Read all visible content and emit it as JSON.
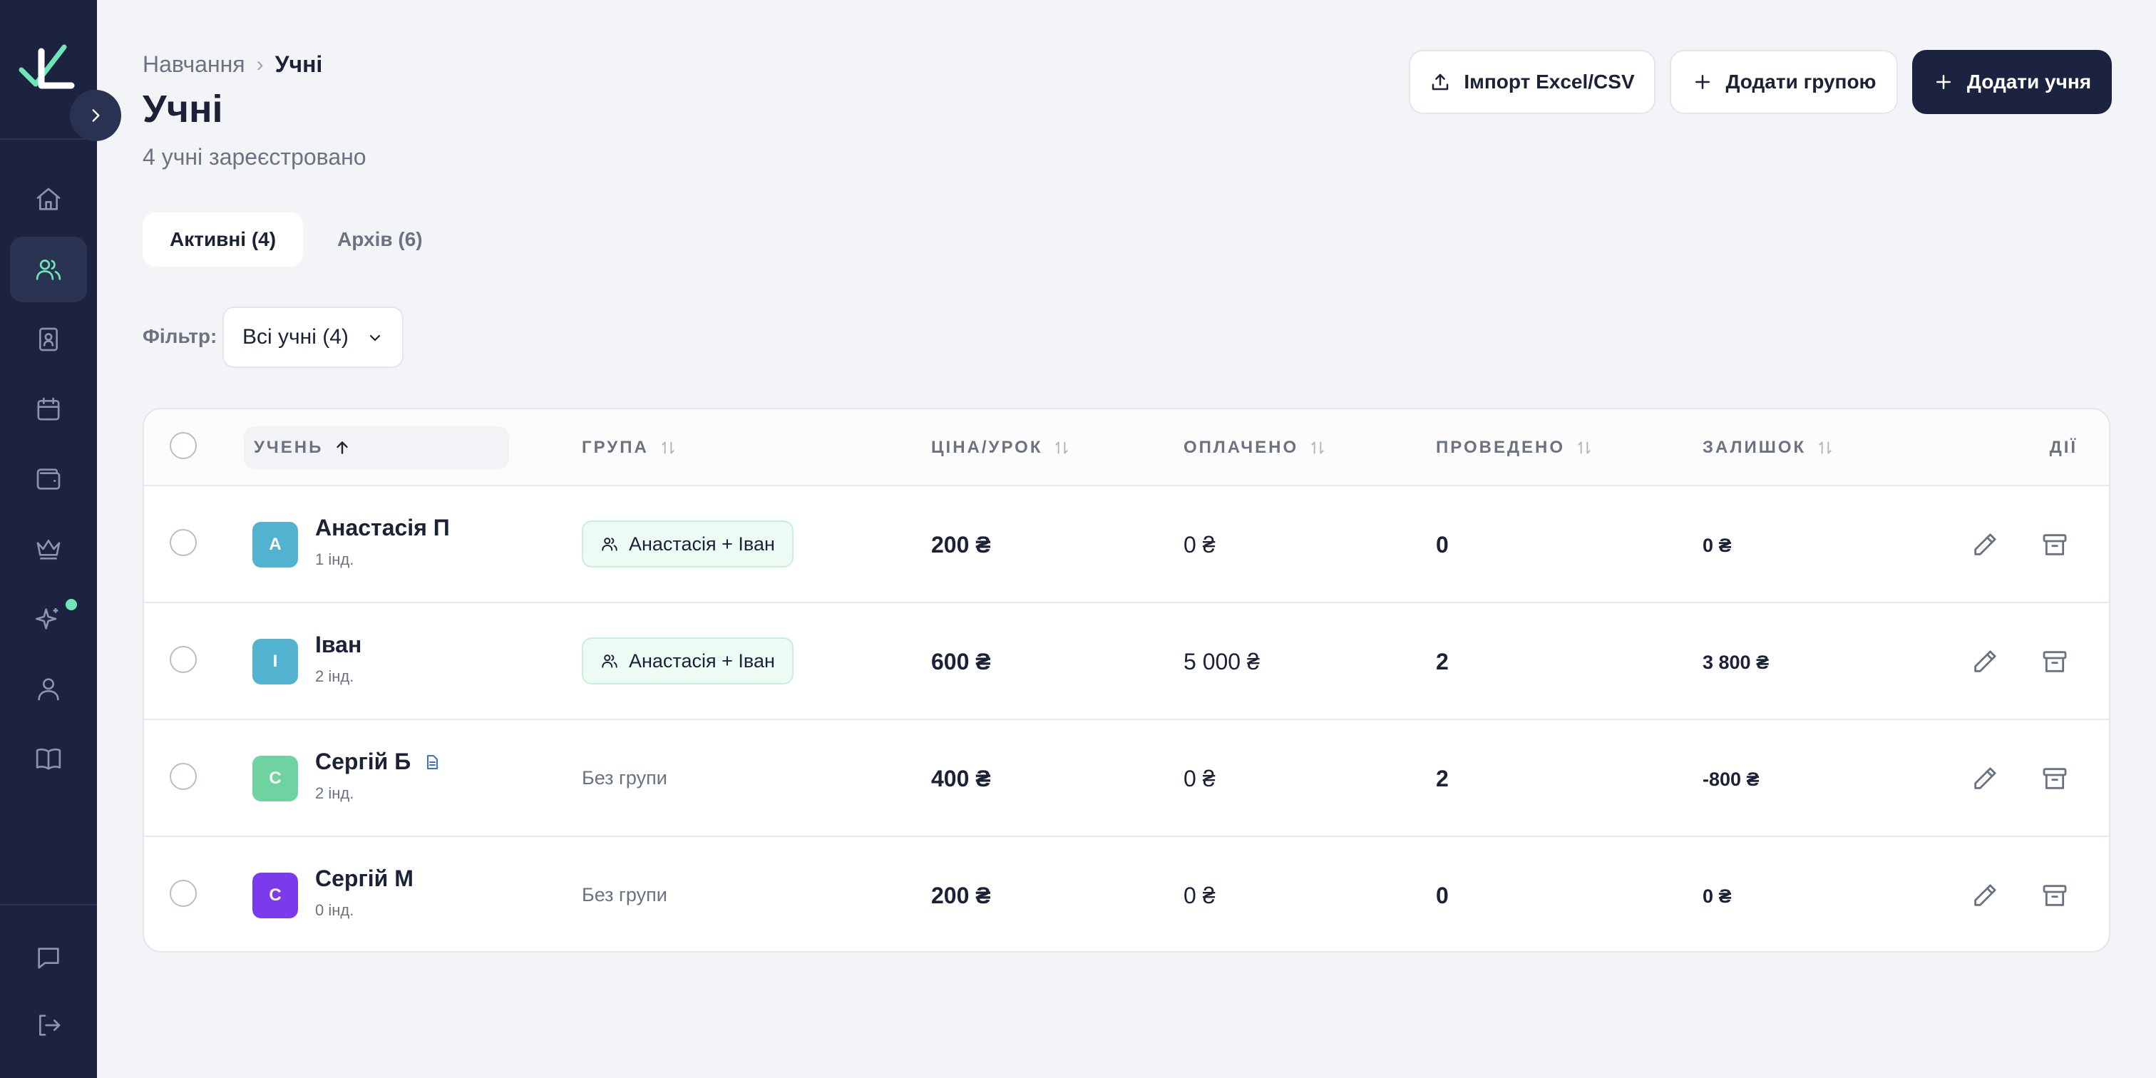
{
  "sidebar": {
    "logo": "checkmark-logo",
    "items": [
      {
        "icon": "home-icon",
        "active": false
      },
      {
        "icon": "users-icon",
        "active": true
      },
      {
        "icon": "contact-book-icon",
        "active": false
      },
      {
        "icon": "calendar-icon",
        "active": false
      },
      {
        "icon": "wallet-icon",
        "active": false
      },
      {
        "icon": "crown-icon",
        "active": false
      },
      {
        "icon": "sparkles-icon",
        "active": false,
        "badge": true
      },
      {
        "icon": "user-icon",
        "active": false
      },
      {
        "icon": "book-icon",
        "active": false
      }
    ],
    "bottom_items": [
      {
        "icon": "chat-icon"
      },
      {
        "icon": "logout-icon"
      }
    ]
  },
  "breadcrumb": {
    "parent": "Навчання",
    "separator": "›",
    "current": "Учні"
  },
  "page": {
    "title": "Учні",
    "subtitle": "4 учні зареєстровано"
  },
  "actions": {
    "import_label": "Імпорт Excel/CSV",
    "add_group_label": "Додати групою",
    "add_student_label": "Додати учня"
  },
  "tabs": [
    {
      "label": "Активні (4)",
      "active": true
    },
    {
      "label": "Архів (6)",
      "active": false
    }
  ],
  "filter": {
    "label": "Фільтр:",
    "value": "Всі учні (4)"
  },
  "table": {
    "columns": {
      "student": "УЧЕНЬ",
      "group": "ГРУПА",
      "price": "ЦІНА/УРОК",
      "paid": "ОПЛАЧЕНО",
      "held": "ПРОВЕДЕНО",
      "balance": "ЗАЛИШОК",
      "actions": "ДІЇ"
    },
    "rows": [
      {
        "initial": "А",
        "avatar_color": "#52b3d0",
        "name": "Анастасія П",
        "lessons": "1 інд.",
        "has_doc": false,
        "group": "Анастасія + Іван",
        "price": "200 ₴",
        "paid": "0 ₴",
        "held": "0",
        "balance": "0 ₴"
      },
      {
        "initial": "І",
        "avatar_color": "#52b3d0",
        "name": "Іван",
        "lessons": "2 інд.",
        "has_doc": false,
        "group": "Анастасія + Іван",
        "price": "600 ₴",
        "paid": "5 000 ₴",
        "held": "2",
        "balance": "3 800 ₴"
      },
      {
        "initial": "С",
        "avatar_color": "#6ed3a0",
        "name": "Сергій Б",
        "lessons": "2 інд.",
        "has_doc": true,
        "group": "Без групи",
        "price": "400 ₴",
        "paid": "0 ₴",
        "held": "2",
        "balance": "-800 ₴"
      },
      {
        "initial": "С",
        "avatar_color": "#7c3aed",
        "name": "Сергій М",
        "lessons": "0 інд.",
        "has_doc": false,
        "group": "Без групи",
        "price": "200 ₴",
        "paid": "0 ₴",
        "held": "0",
        "balance": "0 ₴"
      }
    ]
  }
}
